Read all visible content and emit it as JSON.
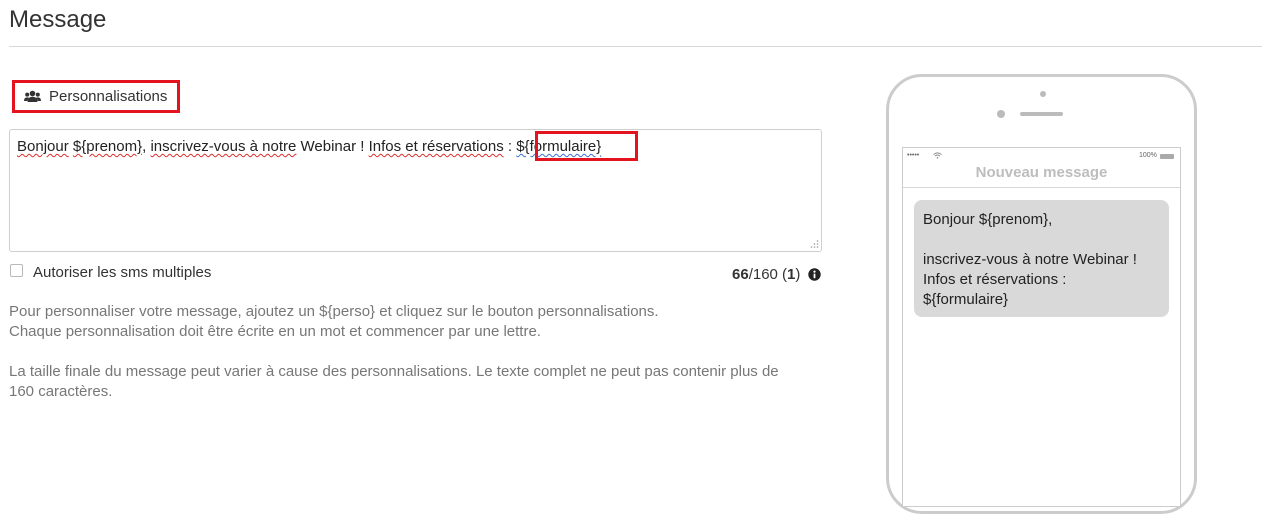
{
  "section": {
    "title": "Message"
  },
  "toolbar": {
    "personalisations_label": "Personnalisations"
  },
  "editor": {
    "segments": [
      {
        "text": "Bonjour",
        "style": "squig"
      },
      {
        "text": " ",
        "style": "plain"
      },
      {
        "text": "${prenom}",
        "style": "squig"
      },
      {
        "text": ", ",
        "style": "plain"
      },
      {
        "text": "inscrivez-vous à notre",
        "style": "squig"
      },
      {
        "text": " Webinar ! ",
        "style": "plain"
      },
      {
        "text": "Infos et réservations",
        "style": "squig"
      },
      {
        "text": " : ",
        "style": "plain"
      },
      {
        "text": "${formulaire}",
        "style": "squig-blue"
      }
    ]
  },
  "options": {
    "multiple_sms_label": "Autoriser les sms multiples",
    "multiple_sms_checked": false
  },
  "counter": {
    "current": "66",
    "max": "/160 (",
    "parts": "1",
    "close": ")"
  },
  "help": {
    "line1": "Pour personnaliser votre message, ajoutez un ${perso} et cliquez sur le bouton personnalisations.",
    "line2": "Chaque personnalisation doit être écrite en un mot et commencer par une lettre.",
    "line3": "La taille finale du message peut varier à cause des personnalisations. Le texte complet ne peut pas contenir plus de",
    "line4": "160 caractères."
  },
  "phone": {
    "status_signal": "•••••",
    "battery_text": "100%",
    "screen_title": "Nouveau message",
    "bubble_text": "Bonjour ${prenom},\n\ninscrivez-vous à notre Webinar !\nInfos et réservations :\n${formulaire}"
  },
  "colors": {
    "highlight": "#e3141e",
    "bubble": "#d9d9d9",
    "muted_text": "#777777"
  },
  "icons": {
    "personalisations": "users-icon",
    "info": "info-circle-icon",
    "wifi": "wifi-icon"
  }
}
